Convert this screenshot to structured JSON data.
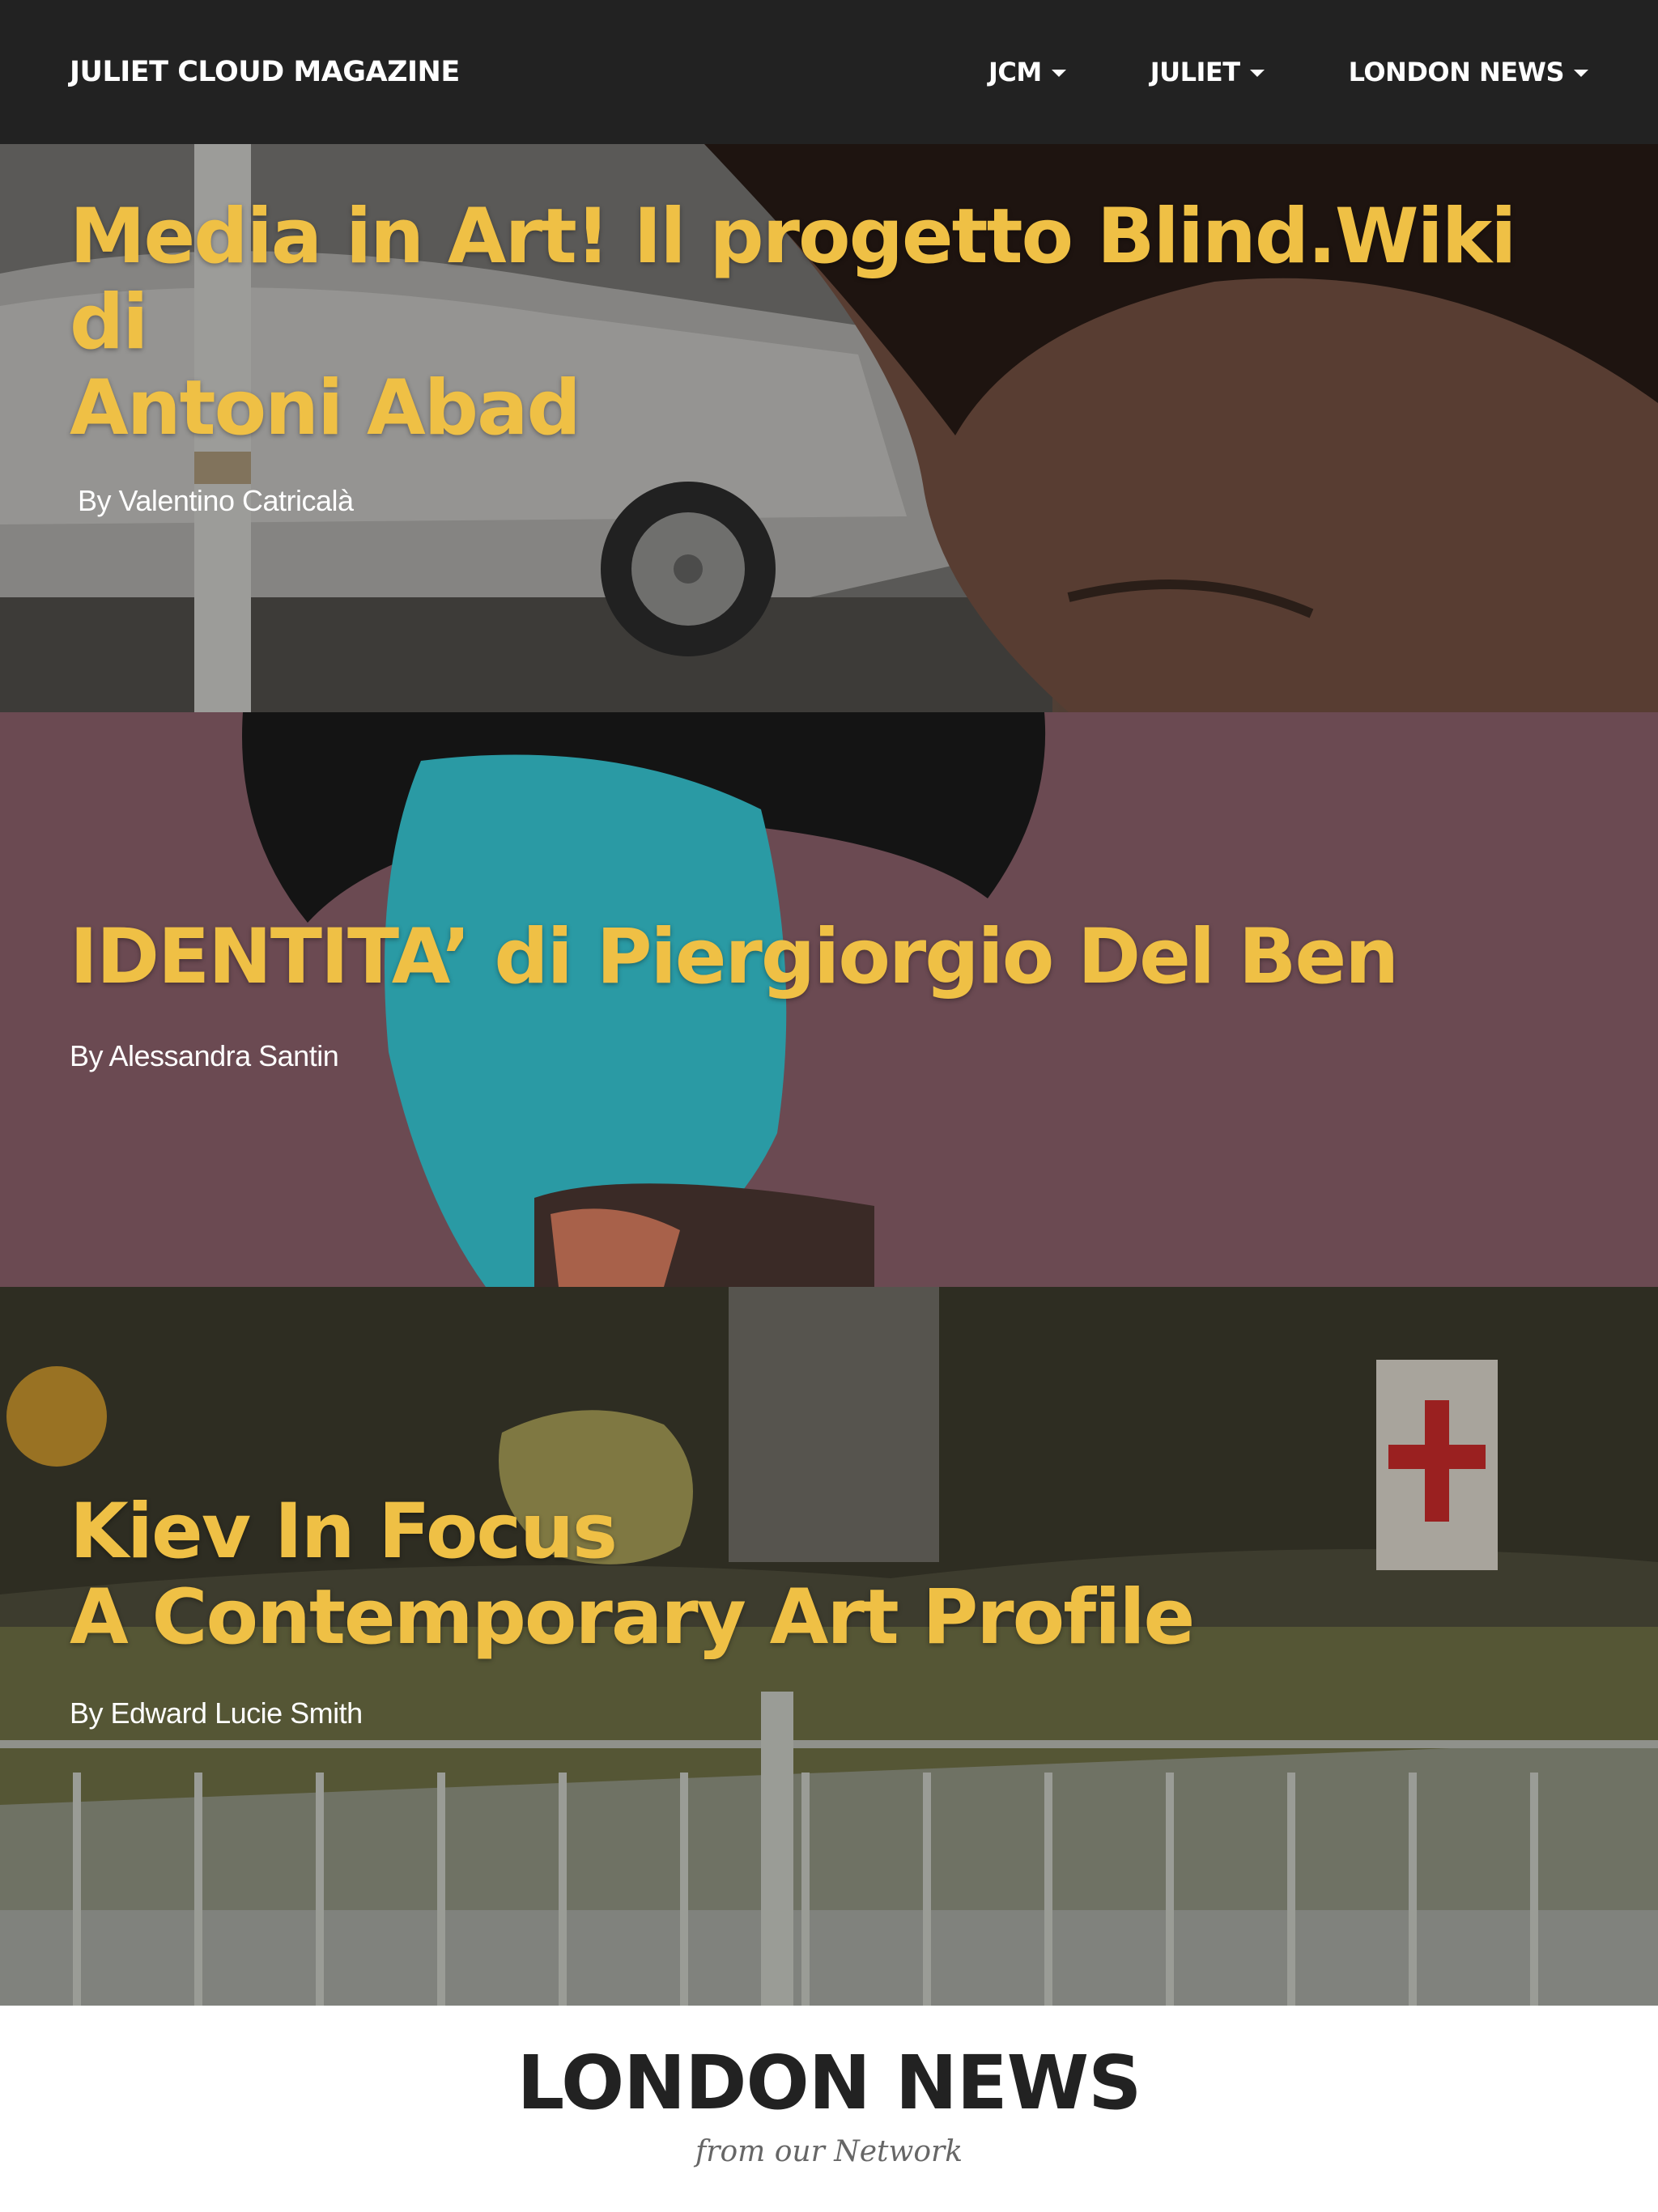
{
  "header": {
    "brand": "JULIET CLOUD MAGAZINE",
    "menu": [
      {
        "label": "JCM"
      },
      {
        "label": "JULIET"
      },
      {
        "label": "LONDON NEWS"
      }
    ]
  },
  "articles": [
    {
      "title_lines": [
        "Media in Art! Il progetto Blind.Wiki di",
        "Antoni Abad"
      ],
      "byline": "By Valentino Catricalà"
    },
    {
      "title_lines": [
        "IDENTITA’ di Piergiorgio Del Ben"
      ],
      "byline": "By Alessandra Santin"
    },
    {
      "title_lines": [
        "Kiev In Focus",
        "A Contemporary Art Profile"
      ],
      "byline": "By Edward Lucie Smith"
    }
  ],
  "london_news": {
    "title": "LONDON NEWS",
    "subtitle": "from our Network"
  },
  "colors": {
    "navbar_bg": "#222222",
    "headline": "#efc045",
    "panel_2_bg": "#6b4a52"
  }
}
